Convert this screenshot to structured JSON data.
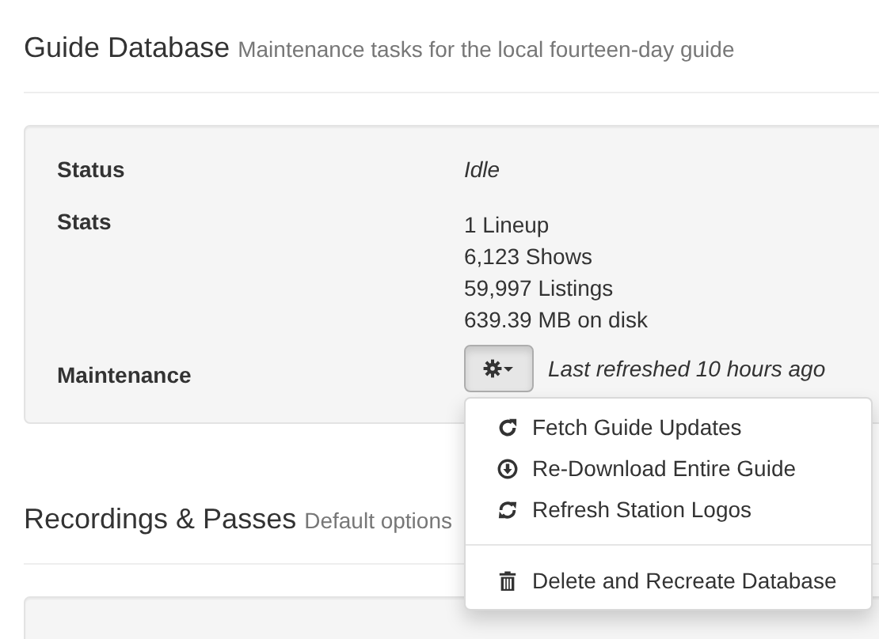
{
  "sections": [
    {
      "title": "Guide Database",
      "subtitle": "Maintenance tasks for the local fourteen-day guide",
      "rows": [
        {
          "kind": "text",
          "label": "Status",
          "value": "Idle"
        },
        {
          "kind": "lines",
          "label": "Stats",
          "lines": [
            "1 Lineup",
            "6,123 Shows",
            "59,997 Listings",
            "639.39 MB on disk"
          ]
        },
        {
          "kind": "maintenance",
          "label": "Maintenance",
          "note": "Last refreshed 10 hours ago",
          "menu_open": true
        }
      ]
    },
    {
      "title": "Recordings & Passes",
      "subtitle": "Default options"
    }
  ],
  "menu": [
    {
      "kind": "refresh",
      "label": "Fetch Guide Updates",
      "divider_before": false
    },
    {
      "kind": "download",
      "label": "Re-Download Entire Guide",
      "divider_before": false
    },
    {
      "kind": "sync",
      "label": "Refresh Station Logos",
      "divider_before": false
    },
    {
      "kind": "trash",
      "label": "Delete and Recreate Database",
      "divider_before": true
    }
  ]
}
